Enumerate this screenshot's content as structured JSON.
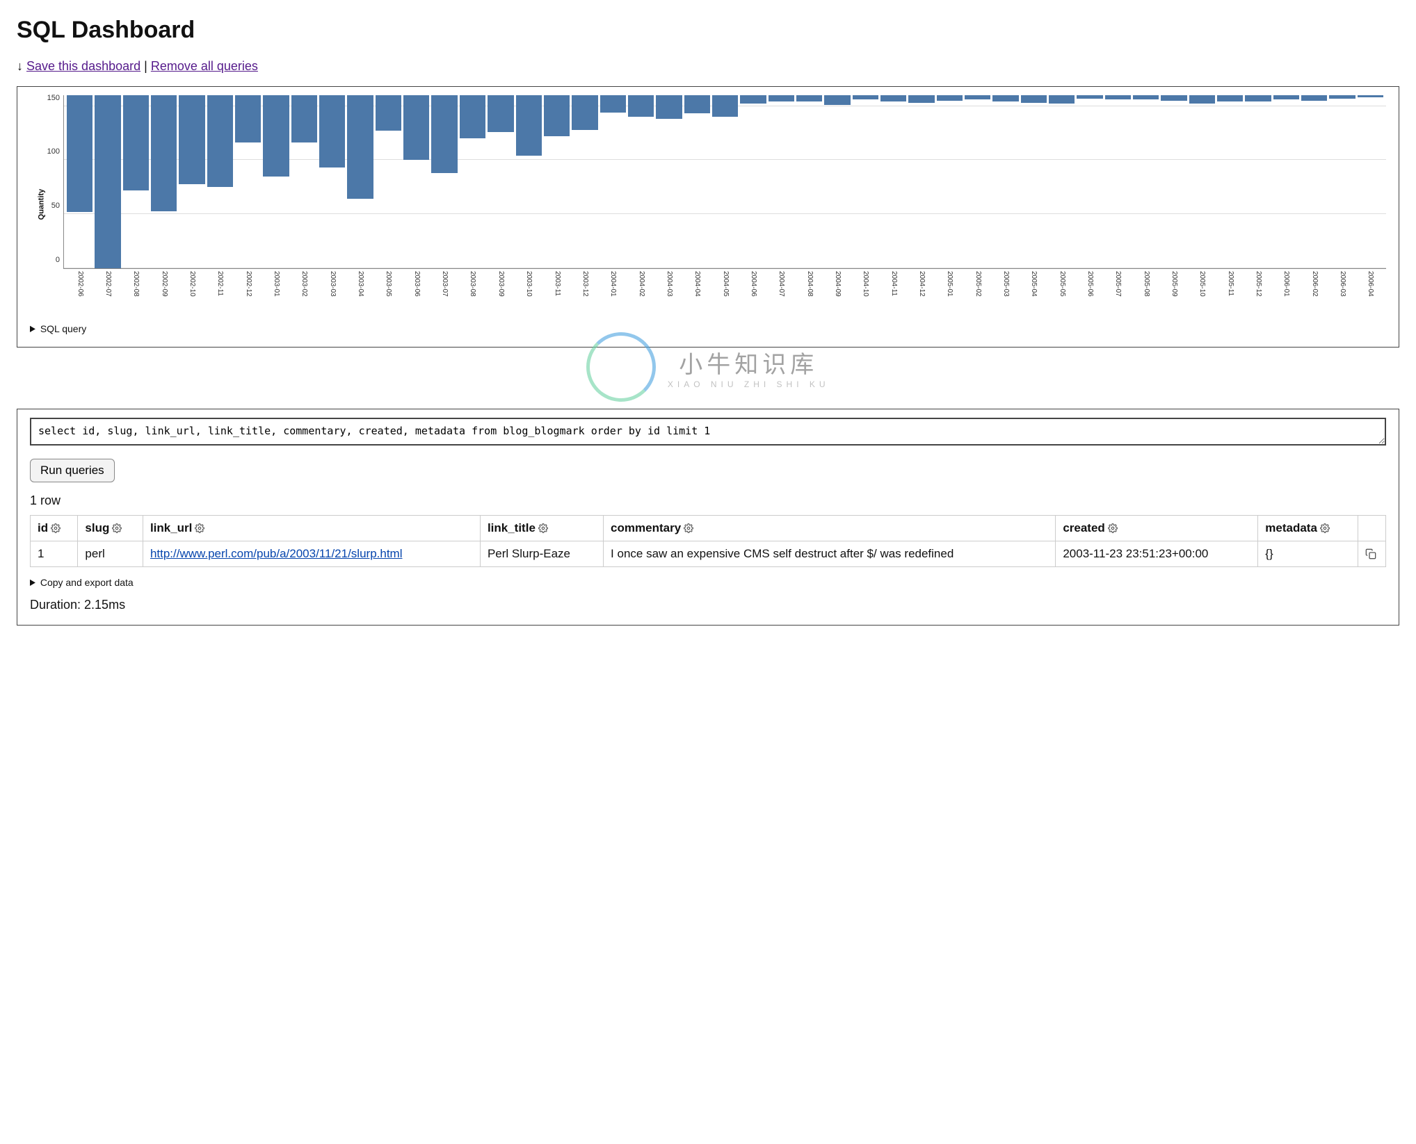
{
  "page_title": "SQL Dashboard",
  "toplinks": {
    "down_arrow": "↓",
    "save_label": "Save this dashboard",
    "separator": " | ",
    "remove_label": "Remove all queries"
  },
  "chart_data": {
    "type": "bar",
    "ylabel": "Quantity",
    "ylim": [
      0,
      160
    ],
    "yticks": [
      0,
      50,
      100,
      150
    ],
    "categories": [
      "2002-06",
      "2002-07",
      "2002-08",
      "2002-09",
      "2002-10",
      "2002-11",
      "2002-12",
      "2003-01",
      "2003-02",
      "2003-03",
      "2003-04",
      "2003-05",
      "2003-06",
      "2003-07",
      "2003-08",
      "2003-09",
      "2003-10",
      "2003-11",
      "2003-12",
      "2004-01",
      "2004-02",
      "2004-03",
      "2004-04",
      "2004-05",
      "2004-06",
      "2004-07",
      "2004-08",
      "2004-09",
      "2004-10",
      "2004-11",
      "2004-12",
      "2005-01",
      "2005-02",
      "2005-03",
      "2005-04",
      "2005-05",
      "2005-06",
      "2005-07",
      "2005-08",
      "2005-09",
      "2005-10",
      "2005-11",
      "2005-12",
      "2006-01",
      "2006-02",
      "2006-03",
      "2006-04"
    ],
    "values": [
      108,
      162,
      88,
      107,
      82,
      85,
      44,
      75,
      44,
      67,
      96,
      33,
      60,
      72,
      40,
      34,
      56,
      38,
      32,
      16,
      20,
      22,
      17,
      20,
      8,
      6,
      6,
      9,
      4,
      6,
      7,
      5,
      4,
      6,
      7,
      8,
      3,
      4,
      4,
      5,
      8,
      6,
      6,
      4,
      5,
      3,
      2
    ]
  },
  "sql_query_toggle": "SQL query",
  "watermark": {
    "cn": "小牛知识库",
    "en": "XIAO NIU ZHI SHI KU"
  },
  "query_panel": {
    "sql": "select id, slug, link_url, link_title, commentary, created, metadata from blog_blogmark order by id limit 1",
    "run_label": "Run queries",
    "rowcount": "1 row",
    "columns": [
      "id",
      "slug",
      "link_url",
      "link_title",
      "commentary",
      "created",
      "metadata"
    ],
    "rows": [
      {
        "id": "1",
        "slug": "perl",
        "link_url": "http://www.perl.com/pub/a/2003/11/21/slurp.html",
        "link_title": "Perl Slurp-Eaze",
        "commentary": "I once saw an expensive CMS self destruct after $/ was redefined",
        "created": "2003-11-23 23:51:23+00:00",
        "metadata": "{}"
      }
    ],
    "export_toggle": "Copy and export data",
    "duration": "Duration: 2.15ms"
  }
}
